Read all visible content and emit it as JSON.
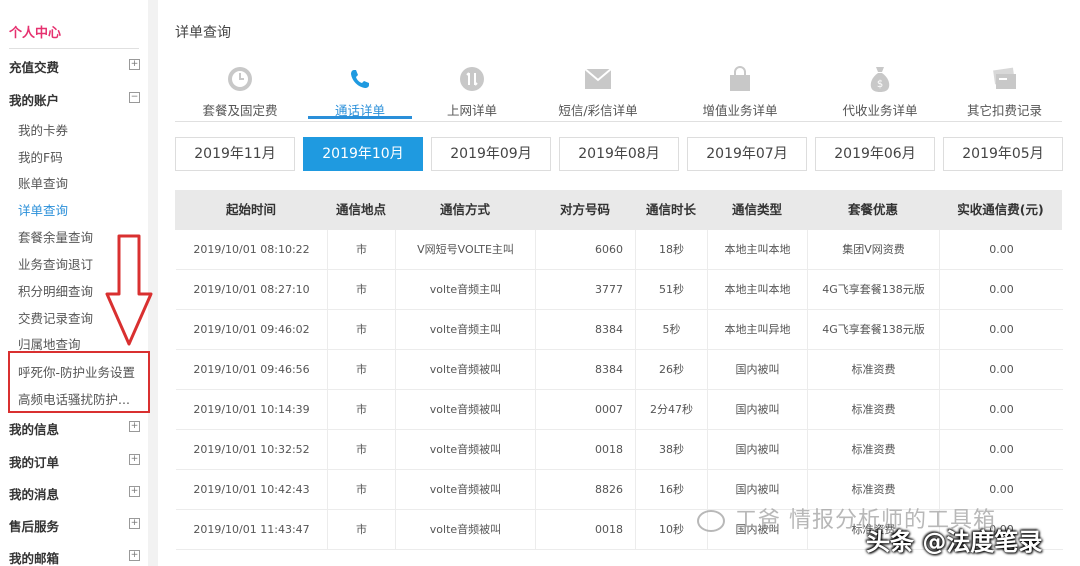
{
  "sidebar": {
    "title": "个人中心",
    "groups": [
      {
        "label": "充值交费",
        "toggle": "+"
      },
      {
        "label": "我的账户",
        "toggle": "−"
      },
      {
        "label": "我的信息",
        "toggle": "+"
      },
      {
        "label": "我的订单",
        "toggle": "+"
      },
      {
        "label": "我的消息",
        "toggle": "+"
      },
      {
        "label": "售后服务",
        "toggle": "+"
      },
      {
        "label": "我的邮箱",
        "toggle": "+"
      }
    ],
    "items": [
      "我的卡券",
      "我的F码",
      "账单查询",
      "详单查询",
      "套餐余量查询",
      "业务查询退订",
      "积分明细查询",
      "交费记录查询",
      "归属地查询",
      "呼死你-防护业务设置",
      "高频电话骚扰防护..."
    ]
  },
  "main": {
    "title": "详单查询",
    "tabs": [
      {
        "label": "套餐及固定费",
        "icon": "clock-icon"
      },
      {
        "label": "通话详单",
        "icon": "phone-icon"
      },
      {
        "label": "上网详单",
        "icon": "data-icon"
      },
      {
        "label": "短信/彩信详单",
        "icon": "mail-icon"
      },
      {
        "label": "增值业务详单",
        "icon": "bag-icon"
      },
      {
        "label": "代收业务详单",
        "icon": "money-bag-icon"
      },
      {
        "label": "其它扣费记录",
        "icon": "card-icon"
      }
    ],
    "months": [
      "2019年11月",
      "2019年10月",
      "2019年09月",
      "2019年08月",
      "2019年07月",
      "2019年06月",
      "2019年05月"
    ],
    "columns": [
      "起始时间",
      "通信地点",
      "通信方式",
      "对方号码",
      "通信时长",
      "通信类型",
      "套餐优惠",
      "实收通信费(元)"
    ],
    "rows": [
      [
        "2019/10/01 08:10:22",
        "市",
        "V网短号VOLTE主叫",
        "6060",
        "18秒",
        "本地主叫本地",
        "集团V网资费",
        "0.00"
      ],
      [
        "2019/10/01 08:27:10",
        "市",
        "volte音频主叫",
        "3777",
        "51秒",
        "本地主叫本地",
        "4G飞享套餐138元版",
        "0.00"
      ],
      [
        "2019/10/01 09:46:02",
        "市",
        "volte音频主叫",
        "8384",
        "5秒",
        "本地主叫异地",
        "4G飞享套餐138元版",
        "0.00"
      ],
      [
        "2019/10/01 09:46:56",
        "市",
        "volte音频被叫",
        "8384",
        "26秒",
        "国内被叫",
        "标准资费",
        "0.00"
      ],
      [
        "2019/10/01 10:14:39",
        "市",
        "volte音频被叫",
        "0007",
        "2分47秒",
        "国内被叫",
        "标准资费",
        "0.00"
      ],
      [
        "2019/10/01 10:32:52",
        "市",
        "volte音频被叫",
        "0018",
        "38秒",
        "国内被叫",
        "标准资费",
        "0.00"
      ],
      [
        "2019/10/01 10:42:43",
        "市",
        "volte音频被叫",
        "8826",
        "16秒",
        "国内被叫",
        "标准资费",
        "0.00"
      ],
      [
        "2019/10/01 11:43:47",
        "市",
        "volte音频被叫",
        "0018",
        "10秒",
        "国内被叫",
        "标准资费",
        "0.00"
      ]
    ]
  },
  "watermark": {
    "text1": "工爸 情报分析师的工具箱",
    "text2": "头条 @法度笔录"
  },
  "colors": {
    "accent": "#1f9ae0",
    "brand": "#e6316f",
    "highlight": "#d93030"
  }
}
